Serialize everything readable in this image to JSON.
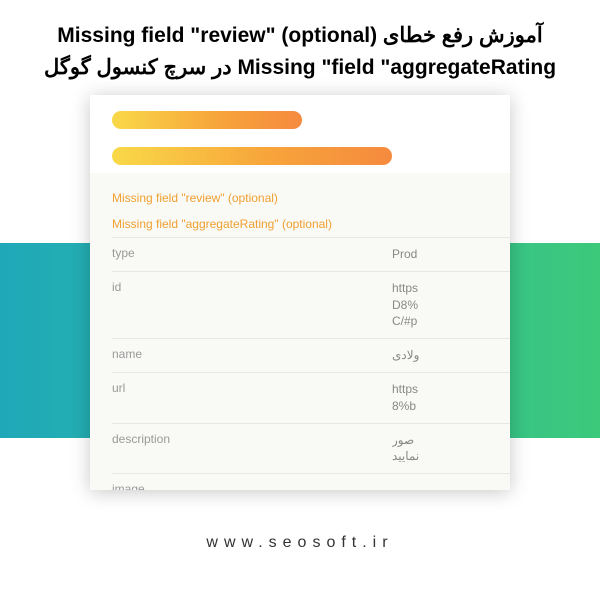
{
  "title": "آموزش رفع خطای Missing field \"review\" (optional) Missing \"field \"aggregateRating در سرچ کنسول گوگل",
  "warnings": {
    "w1": "Missing field \"review\" (optional)",
    "w2": "Missing field \"aggregateRating\" (optional)"
  },
  "rows": {
    "type": {
      "k": "type",
      "v": "Prod"
    },
    "id": {
      "k": "id",
      "v": "https\nD8%\nC/#p"
    },
    "name": {
      "k": "name",
      "v": "ولادی"
    },
    "url": {
      "k": "url",
      "v": "https\n8%b"
    },
    "description": {
      "k": "description",
      "v": "صور\nنمایید"
    },
    "image": {
      "k": "image",
      "v": ""
    }
  },
  "footer": "www.seosoft.ir"
}
